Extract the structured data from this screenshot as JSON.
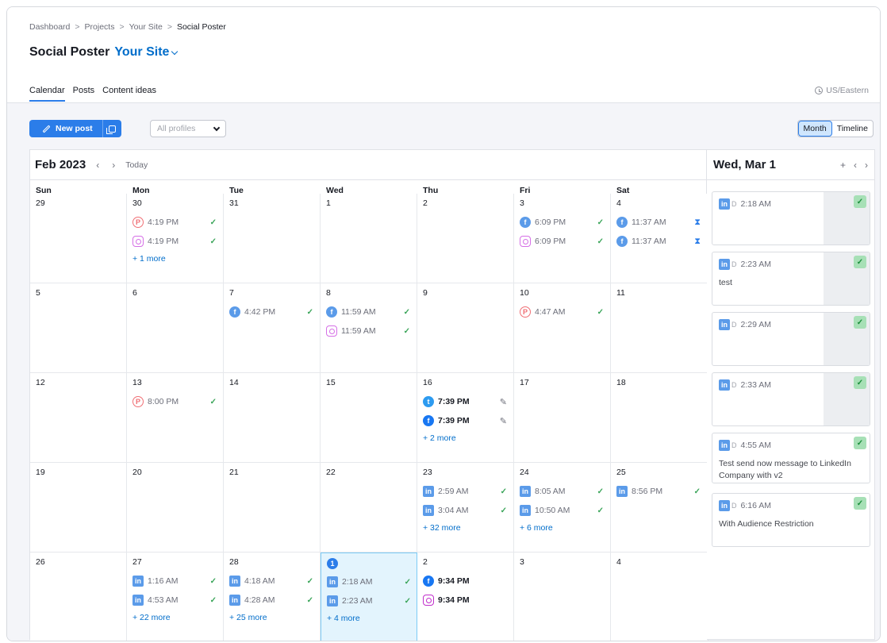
{
  "breadcrumb": {
    "items": [
      "Dashboard",
      "Projects",
      "Your Site"
    ],
    "current": "Social Poster",
    "sep": ">"
  },
  "title": {
    "main": "Social Poster",
    "site": "Your Site"
  },
  "tabs": [
    "Calendar",
    "Posts",
    "Content ideas"
  ],
  "timezone": "US/Eastern",
  "toolbar": {
    "new_post": "New post",
    "profiles_placeholder": "All profiles",
    "views": [
      "Month",
      "Timeline"
    ],
    "active_view": "Month"
  },
  "calendar": {
    "month_label": "Feb 2023",
    "today_label": "Today",
    "day_names": [
      "Sun",
      "Mon",
      "Tue",
      "Wed",
      "Thu",
      "Fri",
      "Sat"
    ],
    "weeks": [
      [
        {
          "day": "29",
          "posts": []
        },
        {
          "day": "30",
          "posts": [
            {
              "net": "pinterest",
              "time": "4:19 PM",
              "status": "check"
            },
            {
              "net": "instagram",
              "time": "4:19 PM",
              "status": "check"
            }
          ],
          "more": "+ 1 more"
        },
        {
          "day": "31",
          "posts": []
        },
        {
          "day": "1",
          "posts": []
        },
        {
          "day": "2",
          "posts": []
        },
        {
          "day": "3",
          "posts": [
            {
              "net": "facebook",
              "time": "6:09 PM",
              "status": "check"
            },
            {
              "net": "instagram",
              "time": "6:09 PM",
              "status": "check"
            }
          ]
        },
        {
          "day": "4",
          "posts": [
            {
              "net": "facebook",
              "time": "11:37 AM",
              "status": "hourglass"
            },
            {
              "net": "facebook",
              "time": "11:37 AM",
              "status": "hourglass"
            }
          ]
        }
      ],
      [
        {
          "day": "5",
          "posts": []
        },
        {
          "day": "6",
          "posts": []
        },
        {
          "day": "7",
          "posts": [
            {
              "net": "facebook",
              "time": "4:42 PM",
              "status": "check"
            }
          ]
        },
        {
          "day": "8",
          "posts": [
            {
              "net": "facebook",
              "time": "11:59 AM",
              "status": "check"
            },
            {
              "net": "instagram",
              "time": "11:59 AM",
              "status": "check"
            }
          ]
        },
        {
          "day": "9",
          "posts": []
        },
        {
          "day": "10",
          "posts": [
            {
              "net": "pinterest",
              "time": "4:47 AM",
              "status": "check"
            }
          ]
        },
        {
          "day": "11",
          "posts": []
        }
      ],
      [
        {
          "day": "12",
          "posts": []
        },
        {
          "day": "13",
          "posts": [
            {
              "net": "pinterest",
              "time": "8:00 PM",
              "status": "check"
            }
          ]
        },
        {
          "day": "14",
          "posts": []
        },
        {
          "day": "15",
          "posts": []
        },
        {
          "day": "16",
          "posts": [
            {
              "net": "twitter",
              "time": "7:39 PM",
              "status": "edit",
              "draft": true
            },
            {
              "net": "facebook",
              "time": "7:39 PM",
              "status": "edit",
              "draft": true
            }
          ],
          "more": "+ 2 more"
        },
        {
          "day": "17",
          "posts": []
        },
        {
          "day": "18",
          "posts": []
        }
      ],
      [
        {
          "day": "19",
          "posts": []
        },
        {
          "day": "20",
          "posts": []
        },
        {
          "day": "21",
          "posts": []
        },
        {
          "day": "22",
          "posts": []
        },
        {
          "day": "23",
          "posts": [
            {
              "net": "linkedin",
              "time": "2:59 AM",
              "status": "check"
            },
            {
              "net": "linkedin",
              "time": "3:04 AM",
              "status": "check"
            }
          ],
          "more": "+ 32 more"
        },
        {
          "day": "24",
          "posts": [
            {
              "net": "linkedin",
              "time": "8:05 AM",
              "status": "check"
            },
            {
              "net": "linkedin",
              "time": "10:50 AM",
              "status": "check"
            }
          ],
          "more": "+ 6 more"
        },
        {
          "day": "25",
          "posts": [
            {
              "net": "linkedin",
              "time": "8:56 PM",
              "status": "check"
            }
          ]
        }
      ],
      [
        {
          "day": "26",
          "posts": []
        },
        {
          "day": "27",
          "posts": [
            {
              "net": "linkedin",
              "time": "1:16 AM",
              "status": "check"
            },
            {
              "net": "linkedin",
              "time": "4:53 AM",
              "status": "check"
            }
          ],
          "more": "+ 22 more"
        },
        {
          "day": "28",
          "posts": [
            {
              "net": "linkedin",
              "time": "4:18 AM",
              "status": "check"
            },
            {
              "net": "linkedin",
              "time": "4:28 AM",
              "status": "check"
            }
          ],
          "more": "+ 25 more"
        },
        {
          "day": "1",
          "today": true,
          "posts": [
            {
              "net": "linkedin",
              "time": "2:18 AM",
              "status": "check"
            },
            {
              "net": "linkedin",
              "time": "2:23 AM",
              "status": "check"
            }
          ],
          "more": "+ 4 more"
        },
        {
          "day": "2",
          "posts": [
            {
              "net": "facebook",
              "time": "9:34 PM",
              "status": "none",
              "draft": true
            },
            {
              "net": "instagram",
              "time": "9:34 PM",
              "status": "none",
              "draft": true
            }
          ]
        },
        {
          "day": "3",
          "posts": []
        },
        {
          "day": "4",
          "posts": []
        }
      ]
    ]
  },
  "side": {
    "title": "Wed, Mar 1",
    "cards": [
      {
        "time": "2:18 AM",
        "text": ""
      },
      {
        "time": "2:23 AM",
        "text": "test"
      },
      {
        "time": "2:29 AM",
        "text": ""
      },
      {
        "time": "2:33 AM",
        "text": ""
      },
      {
        "time": "4:55 AM",
        "text": "Test send now message to LinkedIn Company with v2"
      },
      {
        "time": "6:16 AM",
        "text": "With Audience Restriction"
      }
    ]
  },
  "colors": {
    "accent": "#2b7de9",
    "link": "#006dca",
    "success": "#3aa559",
    "today_bg": "#e3f4fd"
  }
}
